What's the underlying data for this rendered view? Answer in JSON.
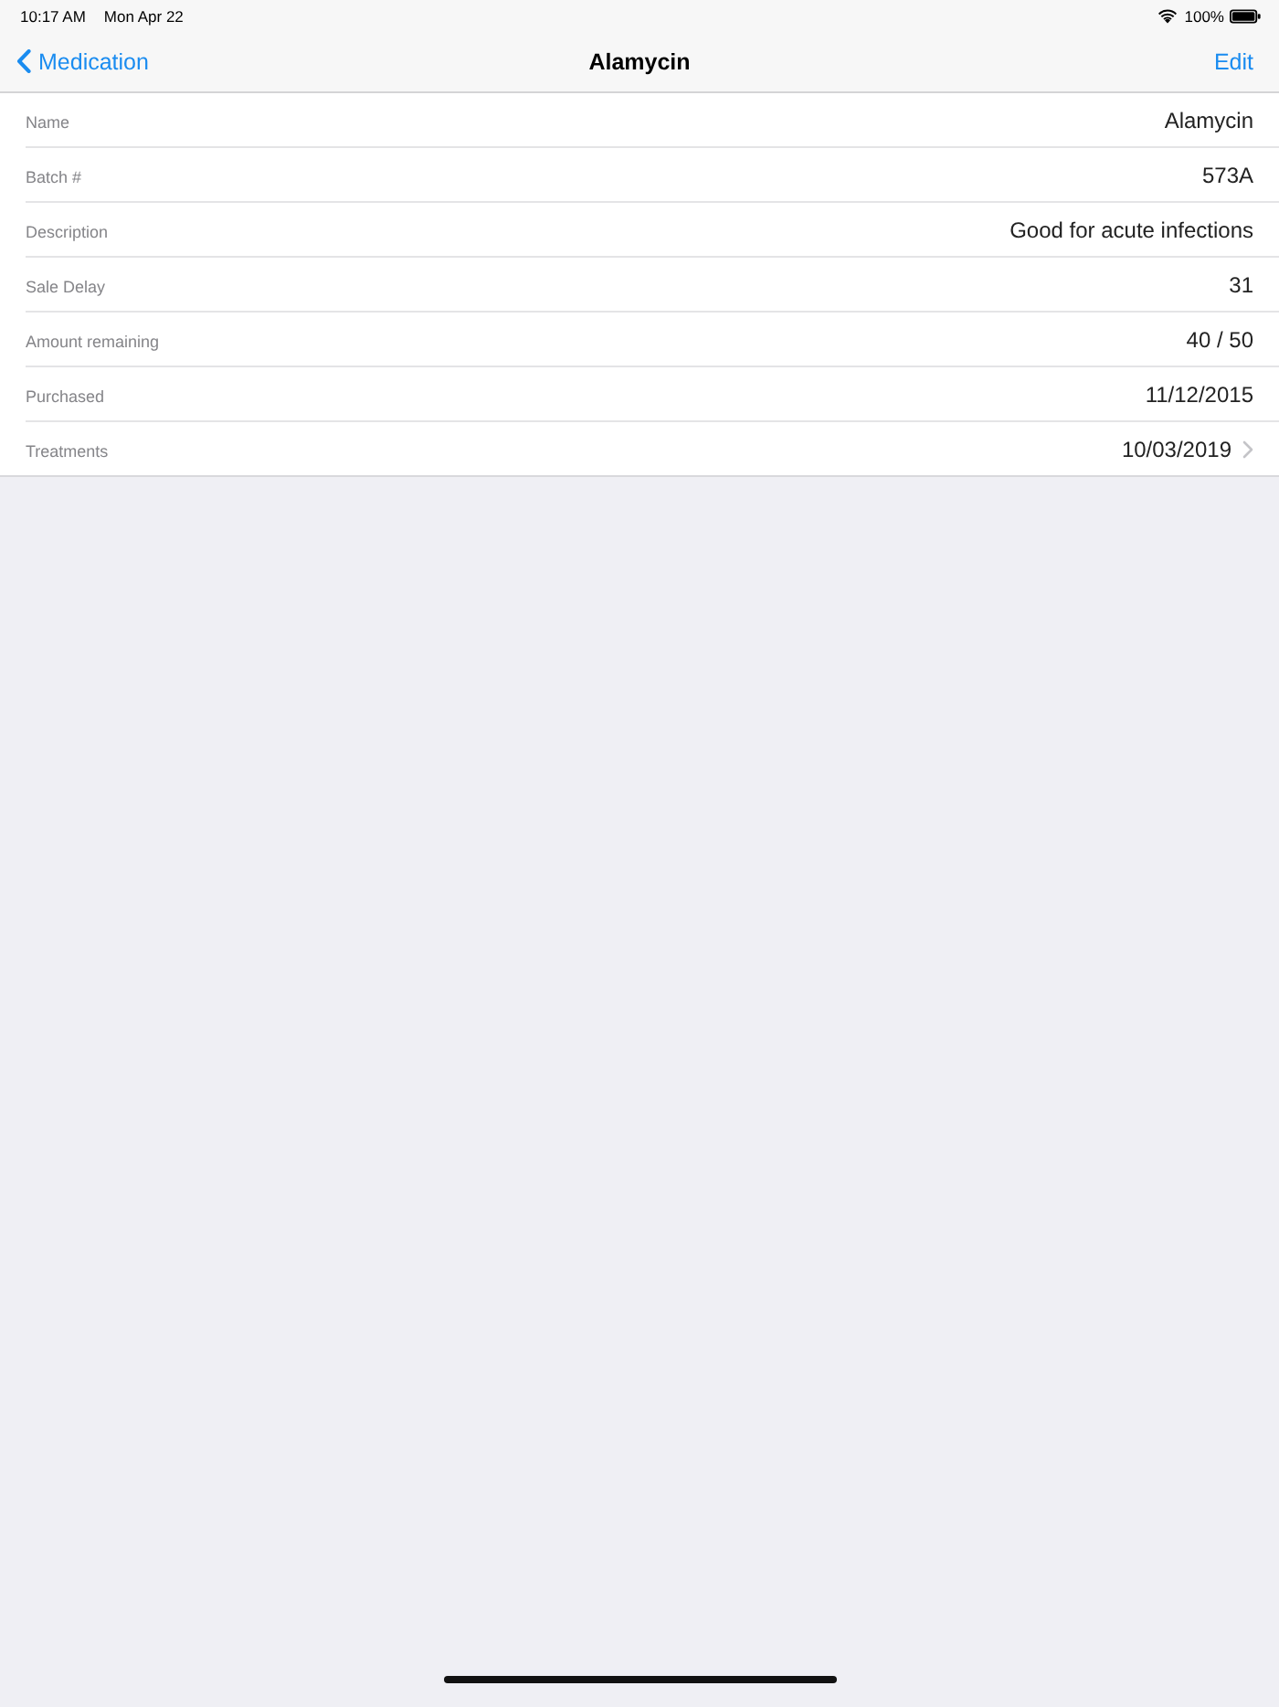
{
  "status_bar": {
    "time": "10:17 AM",
    "date": "Mon Apr 22",
    "battery": "100%"
  },
  "nav_bar": {
    "back": "Medication",
    "title": "Alamycin",
    "action": "Edit"
  },
  "rows": [
    {
      "label": "Name",
      "value": "Alamycin",
      "disclosure": false
    },
    {
      "label": "Batch #",
      "value": "573A",
      "disclosure": false
    },
    {
      "label": "Description",
      "value": "Good for acute infections",
      "disclosure": false
    },
    {
      "label": "Sale Delay",
      "value": "31",
      "disclosure": false
    },
    {
      "label": "Amount remaining",
      "value": "40 / 50",
      "disclosure": false
    },
    {
      "label": "Purchased",
      "value": "11/12/2015",
      "disclosure": false
    },
    {
      "label": "Treatments",
      "value": "10/03/2019",
      "disclosure": true
    }
  ]
}
